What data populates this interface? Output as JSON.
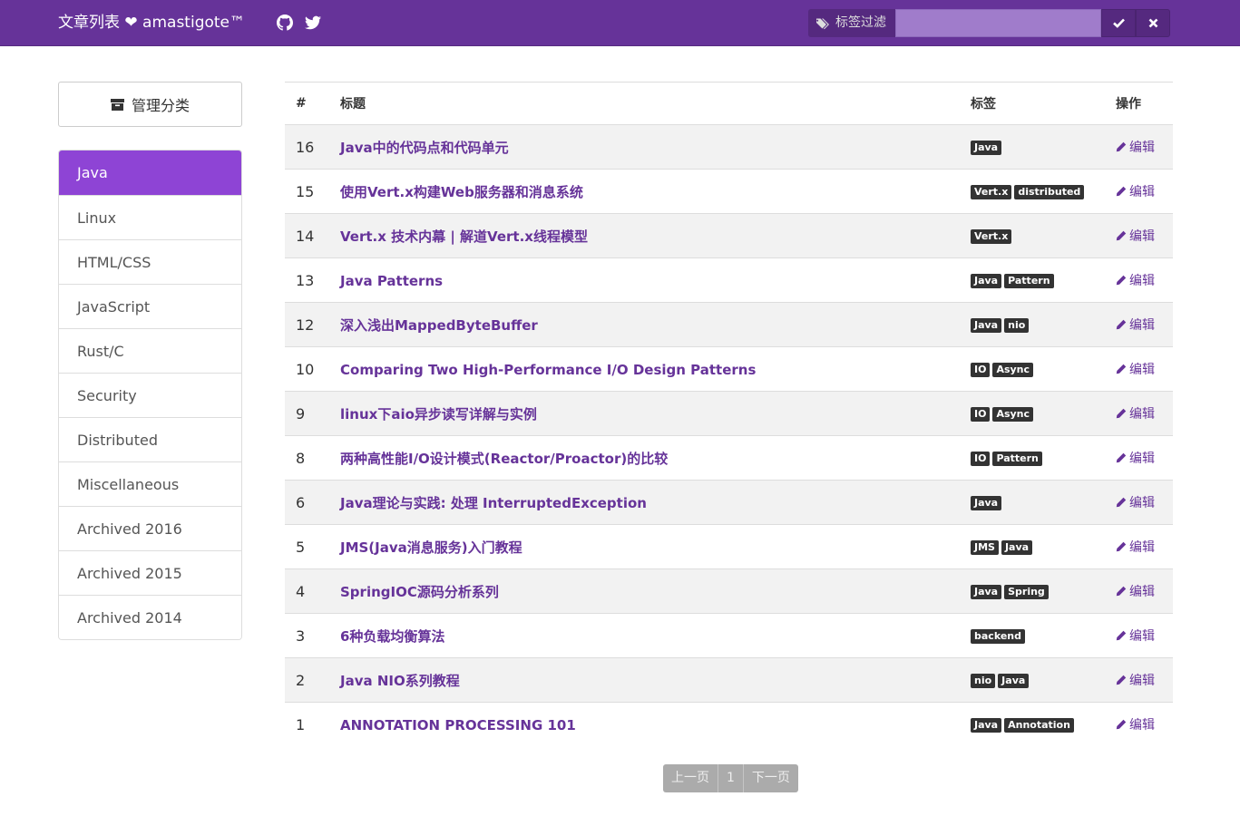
{
  "navbar": {
    "brand": "文章列表 ❤ amastigote™",
    "github_icon": "github-icon",
    "twitter_icon": "twitter-icon",
    "filter_label": "标签过滤",
    "filter_value": "",
    "filter_placeholder": "",
    "confirm_icon": "check-icon",
    "clear_icon": "times-icon"
  },
  "sidebar": {
    "manage_label": "管理分类",
    "manage_icon": "archive-icon",
    "categories": [
      {
        "label": "Java",
        "active": true
      },
      {
        "label": "Linux"
      },
      {
        "label": "HTML/CSS"
      },
      {
        "label": "JavaScript"
      },
      {
        "label": "Rust/C"
      },
      {
        "label": "Security"
      },
      {
        "label": "Distributed"
      },
      {
        "label": "Miscellaneous"
      },
      {
        "label": "Archived 2016"
      },
      {
        "label": "Archived 2015"
      },
      {
        "label": "Archived 2014"
      }
    ]
  },
  "table": {
    "headers": {
      "num": "#",
      "title": "标题",
      "tags": "标签",
      "actions": "操作"
    },
    "edit_label": "编辑",
    "edit_icon": "pencil-icon",
    "rows": [
      {
        "num": "16",
        "title": "Java中的代码点和代码单元",
        "tags": [
          "Java"
        ]
      },
      {
        "num": "15",
        "title": "使用Vert.x构建Web服务器和消息系统",
        "tags": [
          "Vert.x",
          "distributed"
        ]
      },
      {
        "num": "14",
        "title": "Vert.x 技术内幕 | 解道Vert.x线程模型",
        "tags": [
          "Vert.x"
        ]
      },
      {
        "num": "13",
        "title": "Java Patterns",
        "tags": [
          "Java",
          "Pattern"
        ]
      },
      {
        "num": "12",
        "title": "深入浅出MappedByteBuffer",
        "tags": [
          "Java",
          "nio"
        ]
      },
      {
        "num": "10",
        "title": "Comparing Two High-Performance I/O Design Patterns",
        "tags": [
          "IO",
          "Async"
        ]
      },
      {
        "num": "9",
        "title": "linux下aio异步读写详解与实例",
        "tags": [
          "IO",
          "Async"
        ]
      },
      {
        "num": "8",
        "title": "两种高性能I/O设计模式(Reactor/Proactor)的比较",
        "tags": [
          "IO",
          "Pattern"
        ]
      },
      {
        "num": "6",
        "title": "Java理论与实践: 处理 InterruptedException",
        "tags": [
          "Java"
        ]
      },
      {
        "num": "5",
        "title": "JMS(Java消息服务)入门教程",
        "tags": [
          "JMS",
          "Java"
        ]
      },
      {
        "num": "4",
        "title": "SpringIOC源码分析系列",
        "tags": [
          "Java",
          "Spring"
        ]
      },
      {
        "num": "3",
        "title": "6种负载均衡算法",
        "tags": [
          "backend"
        ]
      },
      {
        "num": "2",
        "title": "Java NIO系列教程",
        "tags": [
          "nio",
          "Java"
        ]
      },
      {
        "num": "1",
        "title": "ANNOTATION PROCESSING 101",
        "tags": [
          "Java",
          "Annotation"
        ]
      }
    ]
  },
  "pagination": {
    "prev": "上一页",
    "current": "1",
    "next": "下一页"
  },
  "colors": {
    "navbar": "#663399",
    "active_category": "#8e44d5",
    "link": "#663399",
    "tag": "#333333",
    "pagination": "#ababab"
  }
}
